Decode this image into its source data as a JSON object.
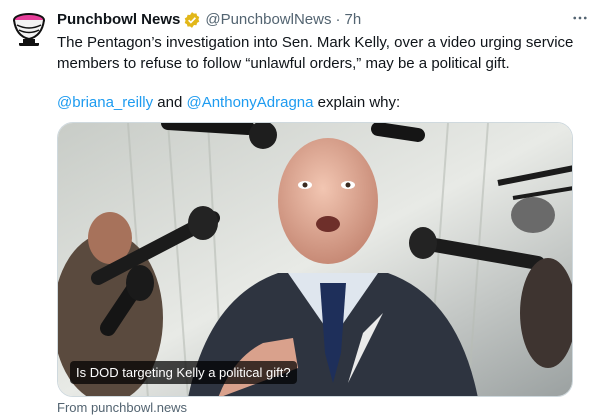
{
  "tweet": {
    "name": "Punchbowl News",
    "handle": "@PunchbowlNews",
    "separator": "·",
    "time": "7h",
    "text_line1": "The Pentagon’s investigation into Sen. Mark Kelly, over a video urging service members to refuse to follow “unlawful orders,” may be a political gift.",
    "mention1": "@briana_reilly",
    "and": " and ",
    "mention2": "@AnthonyAdragna",
    "explain": " explain why:",
    "card_caption": "Is DOD targeting Kelly a political gift?",
    "source": "From punchbowl.news"
  },
  "icons": {
    "verified": "verified-badge-icon",
    "more": "more-icon"
  },
  "colors": {
    "link": "#1d9bf0",
    "verified": "#e2b719",
    "secondary": "#536471"
  }
}
